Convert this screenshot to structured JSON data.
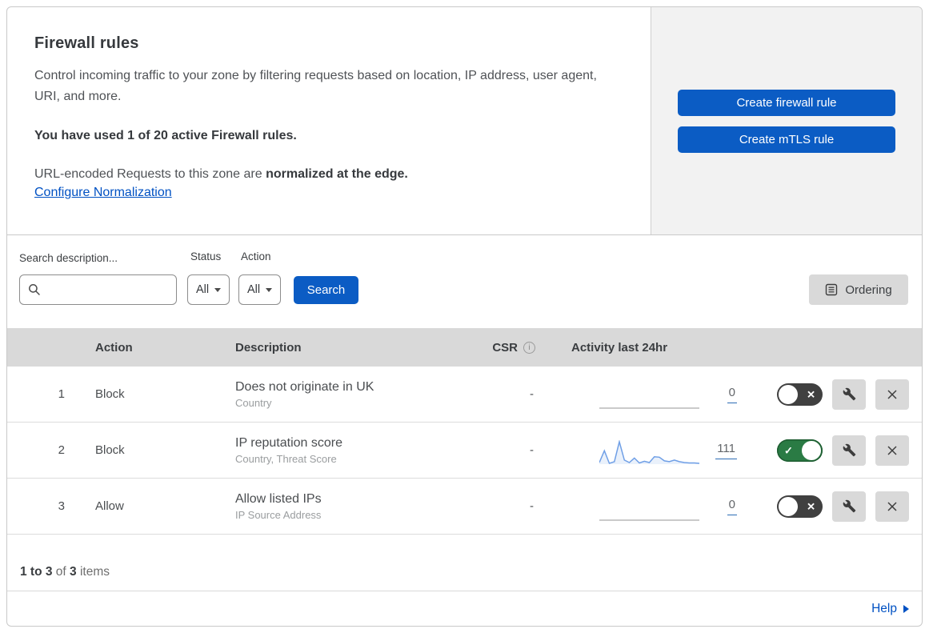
{
  "header": {
    "title": "Firewall rules",
    "description": "Control incoming traffic to your zone by filtering requests based on location, IP address, user agent, URI, and more.",
    "usage": "You have used 1 of 20 active Firewall rules.",
    "norm_prefix": "URL-encoded Requests to this zone are ",
    "norm_bold": "normalized at the edge.",
    "norm_link": "Configure Normalization",
    "actions": [
      {
        "label": "Create firewall rule"
      },
      {
        "label": "Create mTLS rule"
      }
    ]
  },
  "filters": {
    "search_label": "Search description...",
    "status_label": "Status",
    "status_value": "All",
    "action_label": "Action",
    "action_value": "All",
    "search_button": "Search",
    "ordering_button": "Ordering"
  },
  "table": {
    "columns": {
      "action": "Action",
      "description": "Description",
      "csr": "CSR",
      "activity": "Activity last 24hr"
    },
    "rows": [
      {
        "priority": "1",
        "action": "Block",
        "description": "Does not originate in UK",
        "fields": "Country",
        "csr": "-",
        "activity_count": "0",
        "enabled": false,
        "sparkline": [
          0,
          0,
          0,
          0,
          0,
          0,
          0,
          0,
          0,
          0,
          0,
          0,
          0,
          0,
          0,
          0,
          0,
          0,
          0,
          0,
          0
        ]
      },
      {
        "priority": "2",
        "action": "Block",
        "description": "IP reputation score",
        "fields": "Country, Threat Score",
        "csr": "-",
        "activity_count": "111",
        "enabled": true,
        "sparkline": [
          4,
          33,
          2,
          6,
          55,
          10,
          4,
          15,
          3,
          7,
          4,
          18,
          17,
          8,
          6,
          10,
          6,
          4,
          3,
          3,
          2
        ]
      },
      {
        "priority": "3",
        "action": "Allow",
        "description": "Allow listed IPs",
        "fields": "IP Source Address",
        "csr": "-",
        "activity_count": "0",
        "enabled": false,
        "sparkline": [
          0,
          0,
          0,
          0,
          0,
          0,
          0,
          0,
          0,
          0,
          0,
          0,
          0,
          0,
          0,
          0,
          0,
          0,
          0,
          0,
          0
        ]
      }
    ]
  },
  "footer": {
    "range": "1 to 3",
    "of": " of ",
    "total": "3",
    "items": " items",
    "help": "Help"
  },
  "icons": {
    "check": "✓",
    "cross": "✕",
    "info": "i"
  },
  "colors": {
    "button_blue": "#0b5cc4",
    "link_blue": "#0051c3",
    "toggle_on_green": "#2a7b44",
    "toggle_off_gray": "#404040",
    "table_header_gray": "#d9d9d9",
    "panel_gray": "#f2f2f2",
    "spark_line": "#6f9fe6",
    "spark_fill": "#6f9fe6",
    "spark_flat": "#b8b8b8",
    "count_underline": "#2c6cb5"
  }
}
